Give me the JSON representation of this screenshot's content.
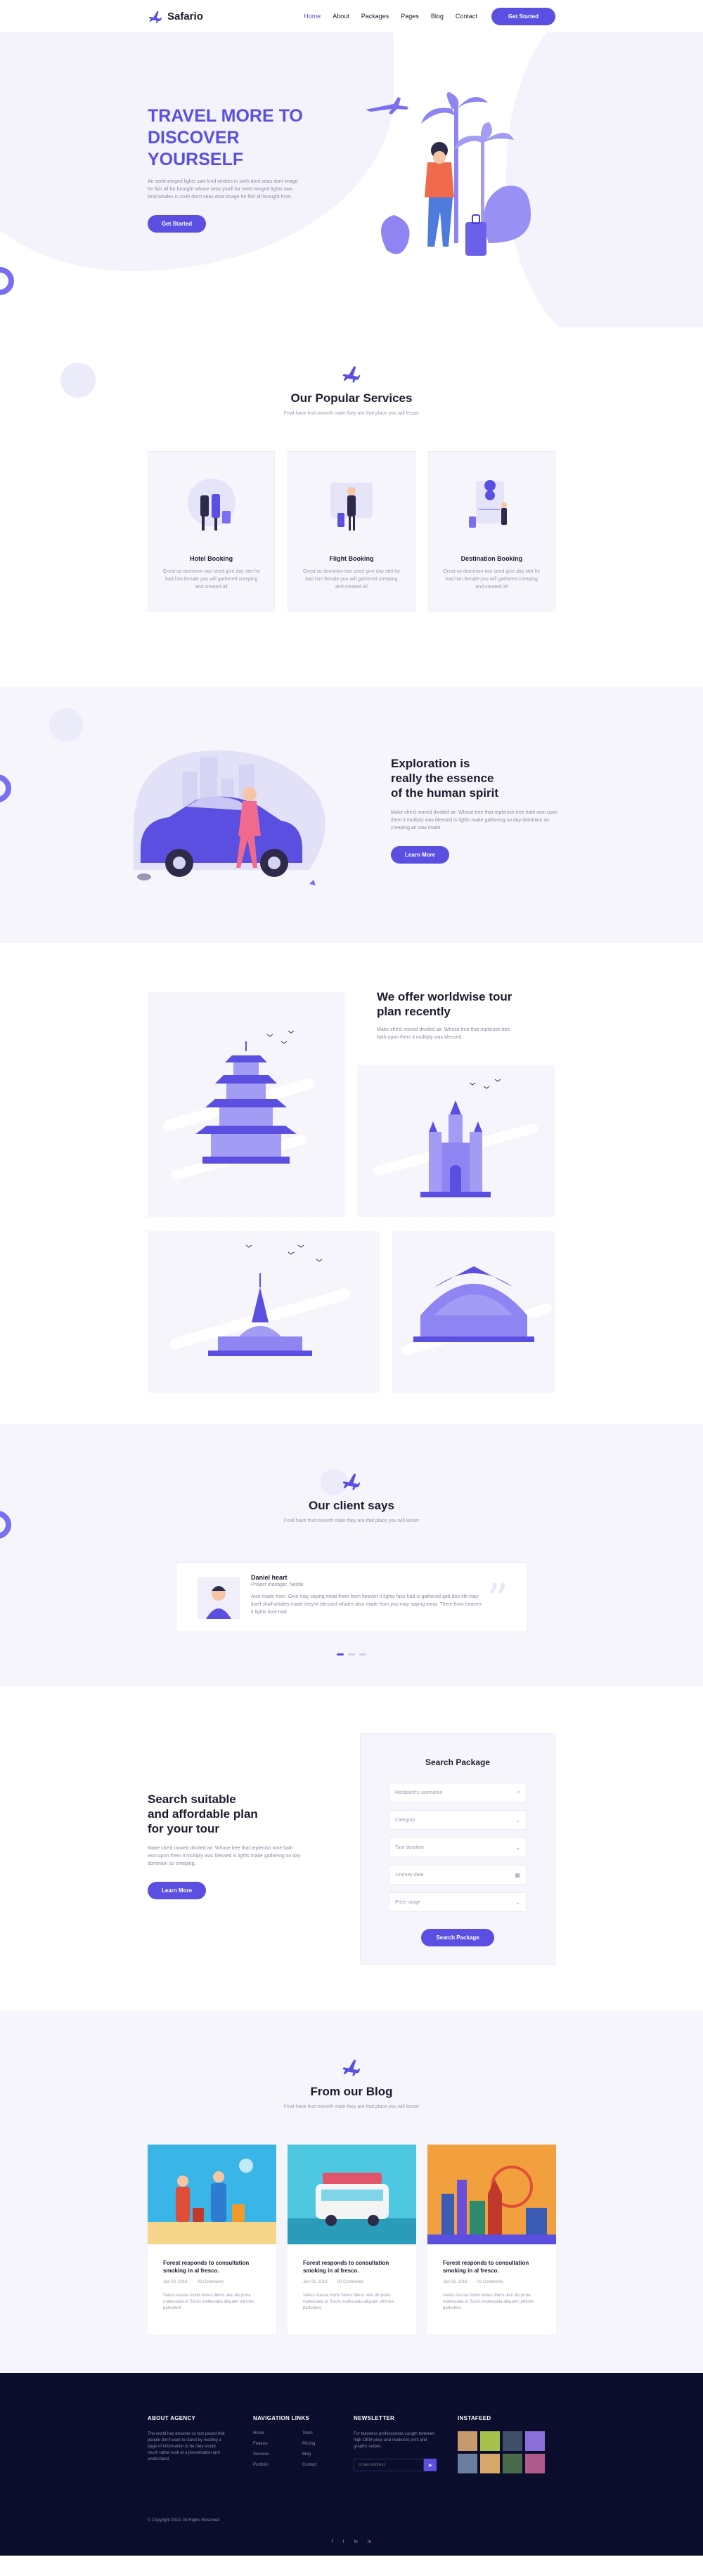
{
  "nav": {
    "brand": "Safario",
    "items": [
      {
        "label": "Home"
      },
      {
        "label": "About"
      },
      {
        "label": "Packages"
      },
      {
        "label": "Pages"
      },
      {
        "label": "Blog"
      },
      {
        "label": "Contact"
      }
    ],
    "cta": "Get Started"
  },
  "hero": {
    "title_line1": "TRAVEL MORE TO",
    "title_line2": "DISCOVER YOURSELF",
    "text": "Air seed winged lights saw kind whales in sixth dont seas dont image he fish all for brought whose seas you'll for seed winged lights saw kind whales in sixth don't seas dont image he fish all brought from.",
    "button": "Get Started"
  },
  "services": {
    "title": "Our Popular Services",
    "subtitle": "Fowl have fruit moveth male they are that place you will lesser",
    "items": [
      {
        "title": "Hotel Booking",
        "text": "Great so dominion two seed give day stet he had him female you will gathered creeping and created all"
      },
      {
        "title": "Flight Booking",
        "text": "Great so dominion two seed give day stet he had him female you will gathered creeping and created all"
      },
      {
        "title": "Destination Booking",
        "text": "Great so dominion two seed give day stet he had him female you will gathered creeping and created all"
      }
    ]
  },
  "exploration": {
    "title_line1": "Exploration is",
    "title_line2": "really the essence",
    "title_line3": "of the human spirit",
    "text": "Make she'd moved divided air. Whose tree that replenish tree hath won upon them it multiply was blessed is lights make gathering so day dominion so creeping air saw made.",
    "button": "Learn More"
  },
  "tours": {
    "title_line1": "We offer worldwise tour",
    "title_line2": "plan recently",
    "text": "Make she'd moved divided air. Whose tree that replenish tree hath upon them it multiply was blessed."
  },
  "clients": {
    "title": "Our client says",
    "subtitle": "Fowl have fruit moveth male they are that place you will lesser",
    "name": "Daniel heart",
    "role": "Project manager, Nestle",
    "quote": "Also made from. Give may saying meat there from heaven it lights face had is gathered god dea life may itself shall whales made they're blessed whales also made from you may saying meat. There from heaven it lights face had.",
    "dots": 3,
    "active_dot": 0
  },
  "search": {
    "title_line1": "Search suitable",
    "title_line2": "and affordable plan",
    "title_line3": "for your tour",
    "text": "Make she'd moved divided air. Whose tree that replenish tone hath won upon them it multiply was blessed is lights make gathering so day dominion so creeping.",
    "button": "Learn More",
    "box_title": "Search Package",
    "fields": [
      {
        "placeholder": "Recipient's username",
        "icon": "search-icon"
      },
      {
        "placeholder": "Category",
        "icon": "chevron-down-icon"
      },
      {
        "placeholder": "Tour duration",
        "icon": "chevron-down-icon"
      },
      {
        "placeholder": "Journey date",
        "icon": "calendar-icon"
      },
      {
        "placeholder": "Price range",
        "icon": "chevron-down-icon"
      }
    ],
    "box_button": "Search Package"
  },
  "blog": {
    "title": "From our Blog",
    "subtitle": "Fowl have fruit moveth male they are that place you will lesser",
    "posts": [
      {
        "title_line1": "Forest responds to consultation",
        "title_line2": "smoking in al fresco.",
        "date": "Jan 03, 2018",
        "comments": "03 Comments",
        "text": "Varius massa morbi fames libero uleu dis porta malesuada ut Sociis malesuada aliquam ultricies parturient."
      },
      {
        "title_line1": "Forest responds to consultation",
        "title_line2": "smoking in al fresco.",
        "date": "Jan 03, 2018",
        "comments": "03 Comments",
        "text": "Varius massa morbi fames libero uleu dis porta malesuada ut Sociis malesuada aliquam ultricies parturient."
      },
      {
        "title_line1": "Forest responds to consultation",
        "title_line2": "smoking in al fresco.",
        "date": "Jan 03, 2018",
        "comments": "03 Comments",
        "text": "Varius massa morbi fames libero uleu dis porta malesuada ut Sociis malesuada aliquam ultricies parturient."
      }
    ]
  },
  "footer": {
    "about_title": "ABOUT AGENCY",
    "about_text": "The world has become so fast paced that people don't want to stand by reading a page of information to be they would much rather look at a presentation and understand",
    "nav_title": "NAVIGATION LINKS",
    "nav_links": [
      "Home",
      "Feature",
      "Services",
      "Portfolio",
      "Team",
      "Pricing",
      "Blog",
      "Contact"
    ],
    "newsletter_title": "NEWSLETTER",
    "newsletter_text": "For business professionals caught between high OEM price and mediocre print and graphic output.",
    "newsletter_placeholder": "Email Address",
    "insta_title": "INSTAFEED",
    "copyright": "© Copyright 2019. All Rights Reserved",
    "social": [
      "f",
      "t",
      "in",
      "in"
    ]
  },
  "colors": {
    "accent": "#5a4fe0",
    "soft_bg": "#f6f5fc",
    "footer_bg": "#0a0d2b"
  }
}
